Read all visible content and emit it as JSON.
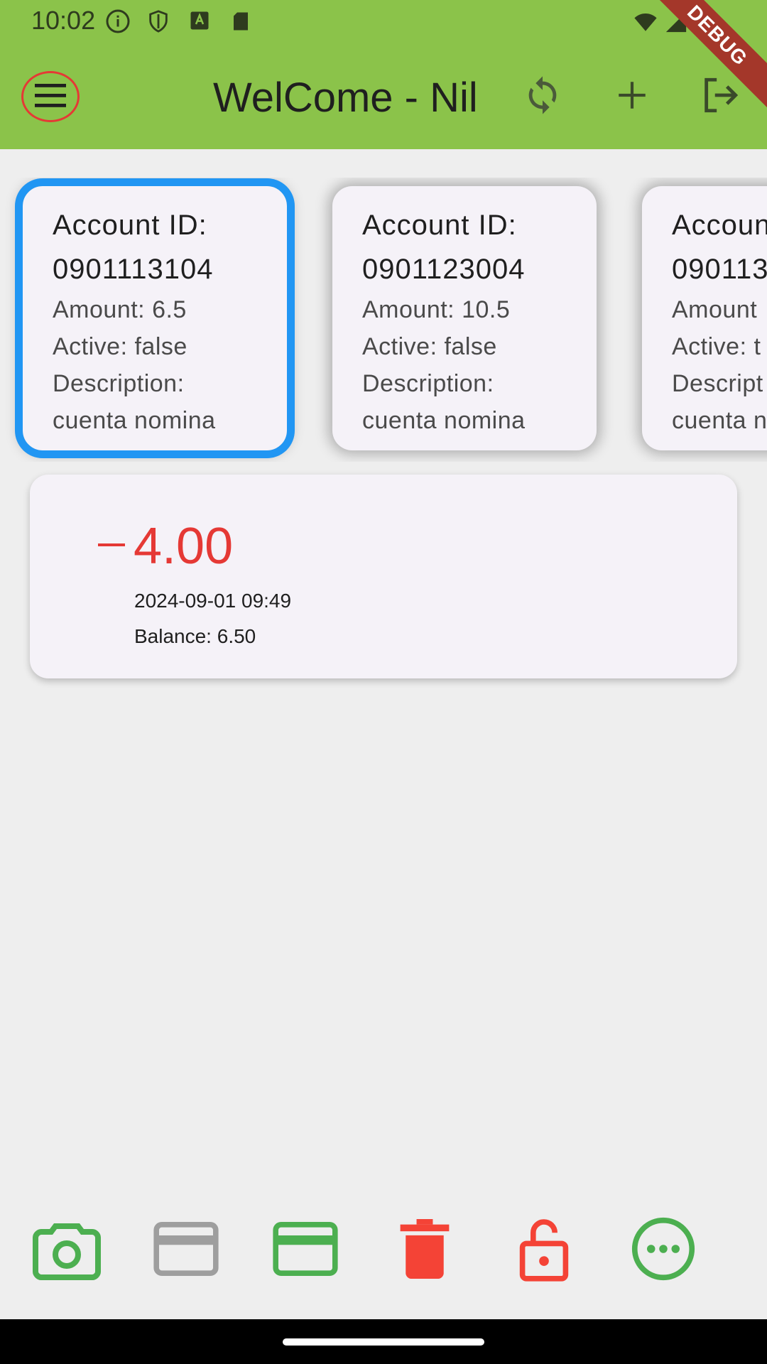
{
  "status": {
    "time": "10:02",
    "icons": [
      "info-icon",
      "shield-icon",
      "a-badge-icon",
      "sd-card-icon",
      "wifi-icon",
      "signal-icon",
      "battery-icon"
    ]
  },
  "appbar": {
    "title": "WelCome - Nil",
    "debug_label": "DEBUG",
    "actions": [
      "refresh-icon",
      "add-icon",
      "logout-icon"
    ],
    "color": "#8bc34a"
  },
  "accounts": [
    {
      "id_label": "Account ID:",
      "id": "0901113104",
      "amount": "Amount: 6.5",
      "active": "Active: false",
      "desc_label": "Description:",
      "desc": "cuenta nomina",
      "selected": true
    },
    {
      "id_label": "Account ID:",
      "id": "0901123004",
      "amount": "Amount: 10.5",
      "active": "Active: false",
      "desc_label": "Description:",
      "desc": "cuenta nomina",
      "selected": false
    },
    {
      "id_label": "Accoun",
      "id": "090113",
      "amount": "Amount",
      "active": "Active: t",
      "desc_label": "Descript",
      "desc": "cuenta n",
      "selected": false
    }
  ],
  "transaction": {
    "sign": "−",
    "amount": "4.00",
    "date": "2024-09-01 09:49",
    "balance": "Balance: 6.50",
    "color": "#e53935"
  },
  "tools": [
    "camera-icon",
    "card-disabled-icon",
    "card-icon",
    "delete-icon",
    "unlock-icon",
    "more-icon"
  ]
}
